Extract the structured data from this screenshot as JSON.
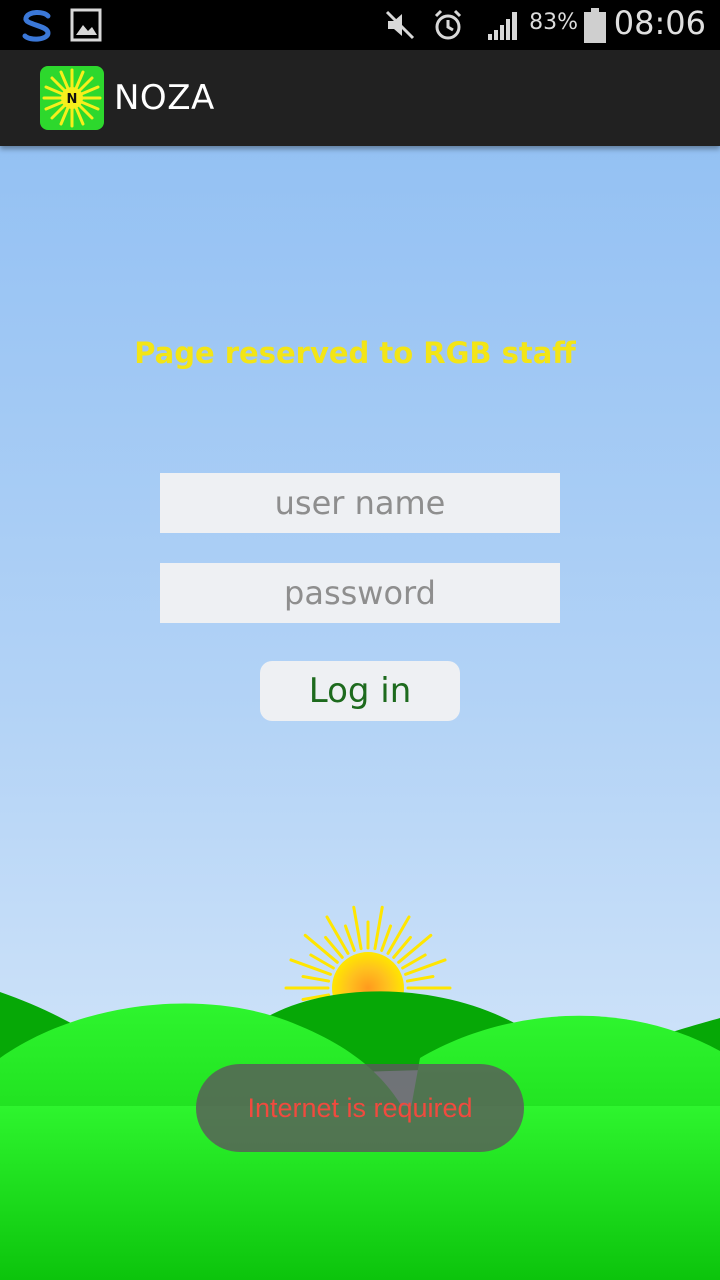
{
  "status_bar": {
    "icons": [
      "sync-app-icon",
      "gallery-icon",
      "mute-icon",
      "alarm-icon",
      "signal-icon",
      "battery-icon"
    ],
    "battery_percent": "83%",
    "time": "08:06"
  },
  "app_bar": {
    "logo_letter": "N",
    "title": "NOZA"
  },
  "login": {
    "notice": "Page reserved to RGB staff",
    "username_placeholder": "user name",
    "password_placeholder": "password",
    "login_label": "Log in"
  },
  "toast": {
    "message": "Internet is required"
  },
  "colors": {
    "notice": "#f3e516",
    "login_text": "#1d6a1d",
    "toast_text": "#f14a3e",
    "hill_light": "#2bef2b",
    "hill_dark": "#06a806",
    "sun": "#ffe600"
  }
}
